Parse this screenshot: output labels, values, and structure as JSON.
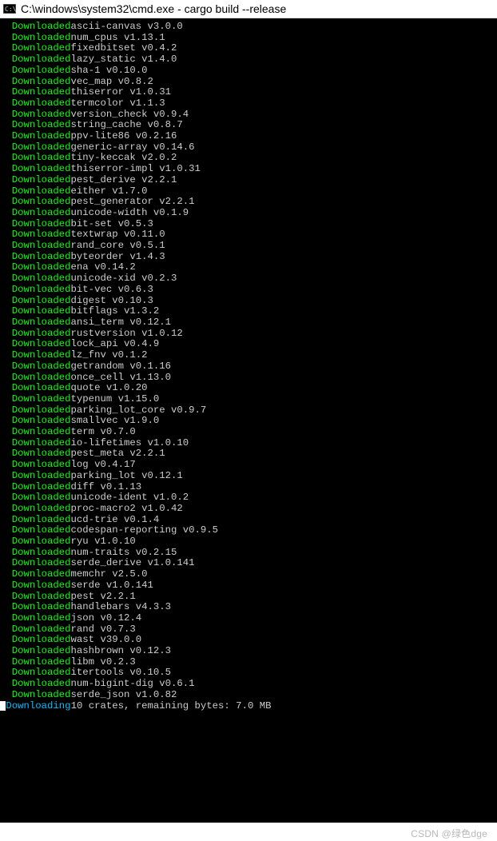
{
  "window": {
    "title": "C:\\windows\\system32\\cmd.exe - cargo  build --release"
  },
  "status_labels": {
    "downloaded": "Downloaded",
    "downloading": "Downloading"
  },
  "downloaded": [
    "ascii-canvas v3.0.0",
    "num_cpus v1.13.1",
    "fixedbitset v0.4.2",
    "lazy_static v1.4.0",
    "sha-1 v0.10.0",
    "vec_map v0.8.2",
    "thiserror v1.0.31",
    "termcolor v1.1.3",
    "version_check v0.9.4",
    "string_cache v0.8.7",
    "ppv-lite86 v0.2.16",
    "generic-array v0.14.6",
    "tiny-keccak v2.0.2",
    "thiserror-impl v1.0.31",
    "pest_derive v2.2.1",
    "either v1.7.0",
    "pest_generator v2.2.1",
    "unicode-width v0.1.9",
    "bit-set v0.5.3",
    "textwrap v0.11.0",
    "rand_core v0.5.1",
    "byteorder v1.4.3",
    "ena v0.14.2",
    "unicode-xid v0.2.3",
    "bit-vec v0.6.3",
    "digest v0.10.3",
    "bitflags v1.3.2",
    "ansi_term v0.12.1",
    "rustversion v1.0.12",
    "lock_api v0.4.9",
    "lz_fnv v0.1.2",
    "getrandom v0.1.16",
    "once_cell v1.13.0",
    "quote v1.0.20",
    "typenum v1.15.0",
    "parking_lot_core v0.9.7",
    "smallvec v1.9.0",
    "term v0.7.0",
    "io-lifetimes v1.0.10",
    "pest_meta v2.2.1",
    "log v0.4.17",
    "parking_lot v0.12.1",
    "diff v0.1.13",
    "unicode-ident v1.0.2",
    "proc-macro2 v1.0.42",
    "ucd-trie v0.1.4",
    "codespan-reporting v0.9.5",
    "ryu v1.0.10",
    "num-traits v0.2.15",
    "serde_derive v1.0.141",
    "memchr v2.5.0",
    "serde v1.0.141",
    "pest v2.2.1",
    "handlebars v4.3.3",
    "json v0.12.4",
    "rand v0.7.3",
    "wast v39.0.0",
    "hashbrown v0.12.3",
    "libm v0.2.3",
    "itertools v0.10.5",
    "num-bigint-dig v0.6.1",
    "serde_json v1.0.82"
  ],
  "downloading_line": "10 crates, remaining bytes: 7.0 MB",
  "watermark": "CSDN @绿色dge"
}
